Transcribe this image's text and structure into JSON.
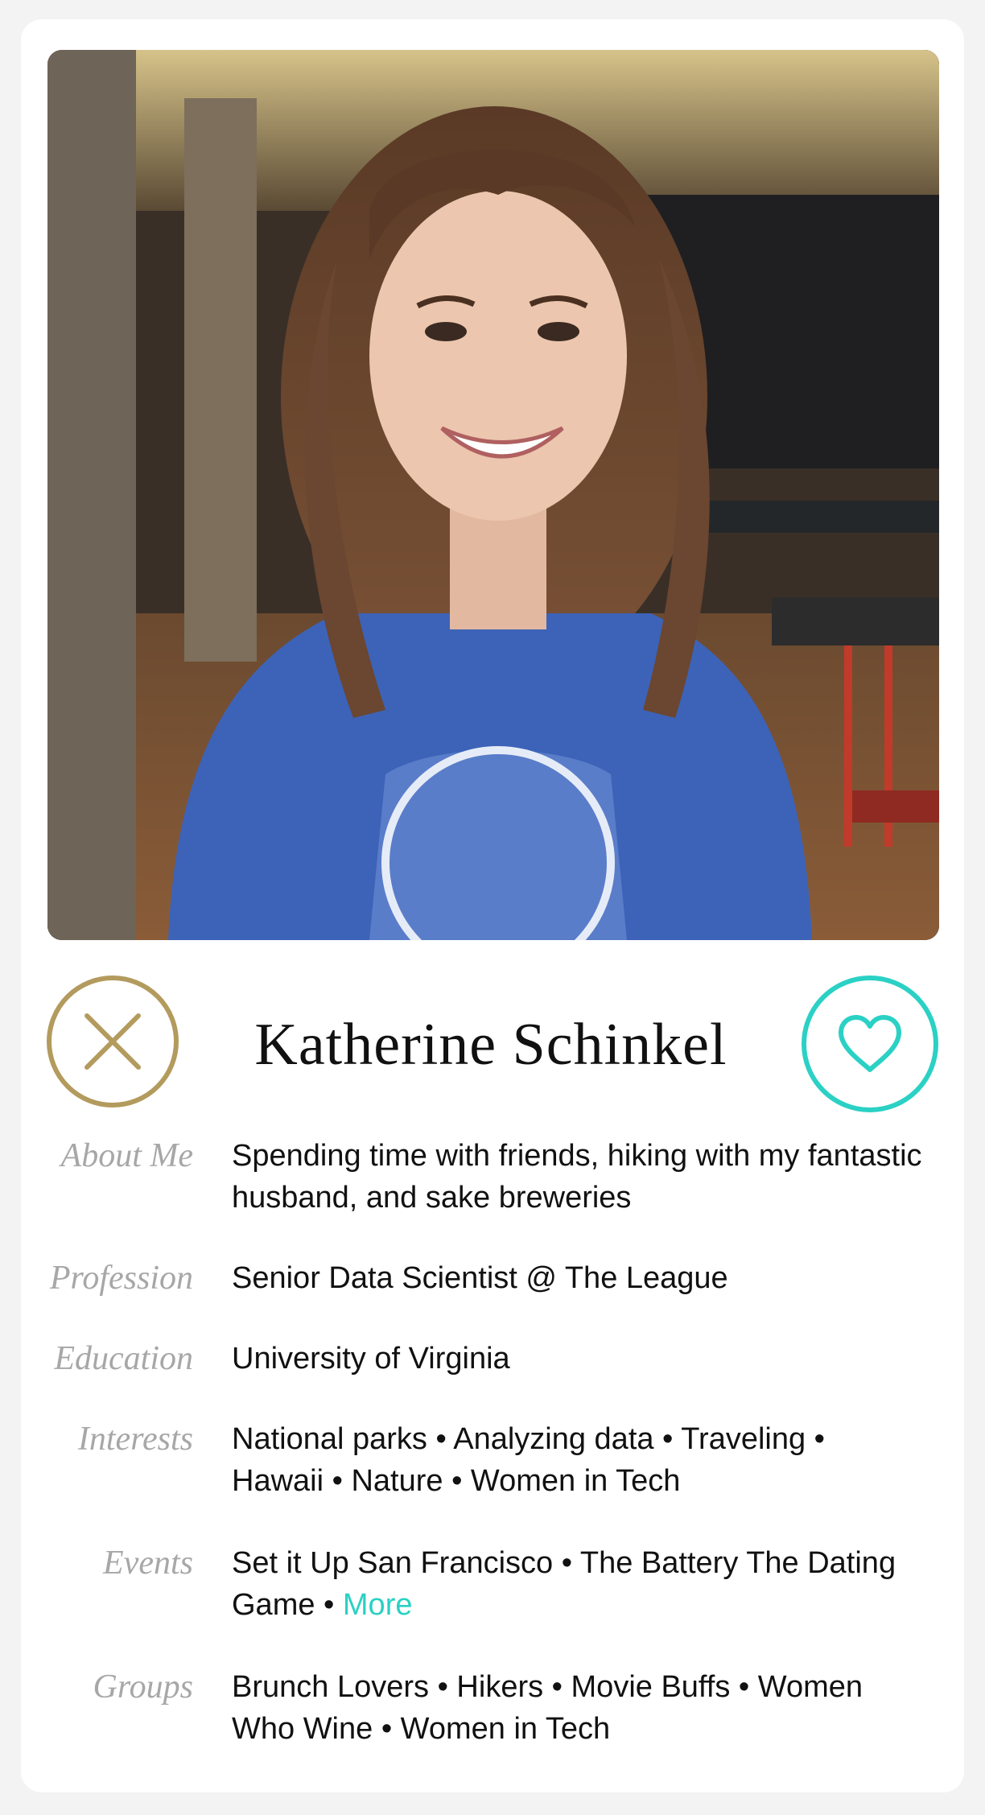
{
  "profile": {
    "name": "Katherine Schinkel",
    "photo_icon": "profile-photo",
    "actions": {
      "pass_icon": "close-icon",
      "like_icon": "heart-icon",
      "pass_color": "#b39b5e",
      "like_color": "#2ad1c4"
    }
  },
  "details": {
    "about": {
      "label": "About Me",
      "text": "Spending time with friends, hiking with my fantastic husband, and sake breweries"
    },
    "profession": {
      "label": "Profession",
      "text": "Senior Data Scientist @ The League"
    },
    "education": {
      "label": "Education",
      "text": "University of Virginia"
    },
    "interests": {
      "label": "Interests",
      "text": "National parks • Analyzing data • Traveling • Hawaii • Nature • Women in Tech"
    },
    "events": {
      "label": "Events",
      "text": "Set it Up San Francisco • The Battery The Dating Game • ",
      "more": "More"
    },
    "groups": {
      "label": "Groups",
      "text": "Brunch Lovers • Hikers • Movie Buffs • Women Who Wine • Women in Tech"
    }
  },
  "colors": {
    "accent": "#2ad1c4",
    "gold": "#b39b5e",
    "label_gray": "#a7a7a7"
  }
}
